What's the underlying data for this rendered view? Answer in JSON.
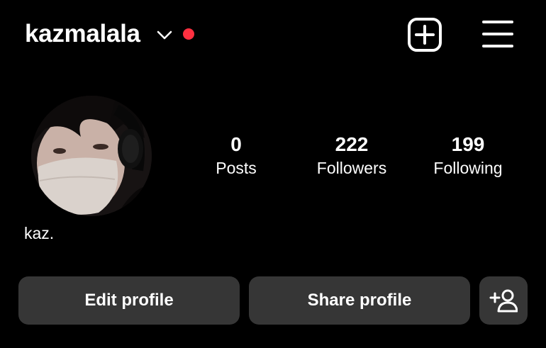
{
  "header": {
    "username": "kazmalala",
    "notification_dot_color": "#ff3040",
    "icons": [
      "chevron-down-icon",
      "new-post-icon",
      "menu-icon"
    ]
  },
  "profile": {
    "display_name": "kaz.",
    "stats": [
      {
        "value": "0",
        "label": "Posts"
      },
      {
        "value": "222",
        "label": "Followers"
      },
      {
        "value": "199",
        "label": "Following"
      }
    ]
  },
  "actions": {
    "edit_label": "Edit profile",
    "share_label": "Share profile",
    "discover_icon": "add-person-icon"
  },
  "colors": {
    "background": "#000000",
    "button_bg": "#363636",
    "text": "#ffffff"
  }
}
